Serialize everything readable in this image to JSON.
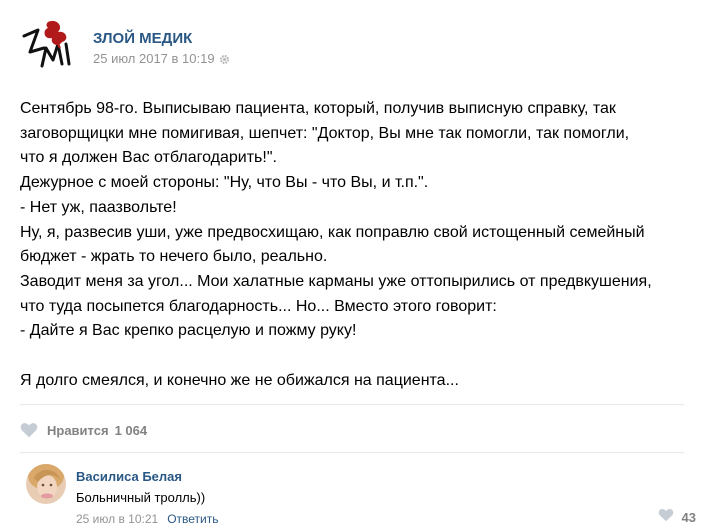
{
  "post": {
    "author": "ЗЛОЙ МЕДИК",
    "date": "25 июл 2017 в 10:19",
    "lines": [
      "Сентябрь 98-го. Выписываю пациента, который, получив выписную справку, так",
      "заговорщицки мне помигивая, шепчет: \"Доктор, Вы мне так помогли, так помогли,",
      "что я должен Вас отблагодарить!\".",
      "Дежурное с моей стороны: \"Ну, что Вы - что Вы, и т.п.\".",
      "- Нет уж, паазвольте!",
      "Ну, я, развесив уши, уже предвосхищаю, как поправлю свой истощенный семейный",
      "бюджет - жрать то нечего было, реально.",
      "Заводит меня за угол... Мои халатные карманы уже оттопырились от предвкушения,",
      "что туда посыпется благодарность... Но... Вместо этого говорит:",
      "- Дайте я Вас крепко расцелую и пожму руку!",
      "Я долго смеялся, и конечно же не обижался на пациента..."
    ],
    "likes_label": "Нравится",
    "likes_count": "1 064"
  },
  "comment": {
    "author": "Василиса Белая",
    "text": "Больничный тролль))",
    "date": "25 июл в 10:21",
    "reply_label": "Ответить",
    "likes_count": "43"
  },
  "colors": {
    "link": "#2a5885",
    "meta": "#939393",
    "logo_red": "#b11a1a"
  },
  "icons": [
    "logo-icon",
    "gear-icon",
    "heart-icon",
    "avatar"
  ]
}
